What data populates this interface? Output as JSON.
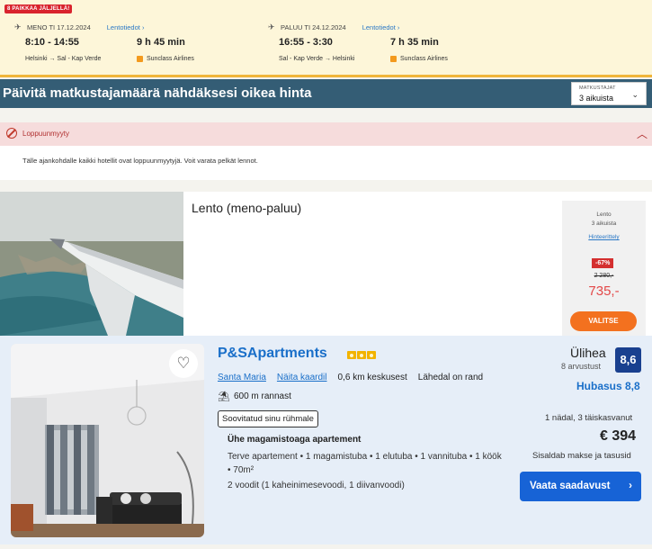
{
  "flight": {
    "seats_badge": "8 PAIKKAA JÄLJELLÄ!",
    "outbound": {
      "label": "MENO TI 17.12.2024",
      "details_link": "Lentotiedot",
      "times": "8:10 - 14:55",
      "duration": "9 h 45 min",
      "route": "Helsinki → Sal - Kap Verde",
      "airline": "Sunclass Airlines"
    },
    "return": {
      "label": "PALUU TI 24.12.2024",
      "details_link": "Lentotiedot",
      "times": "16:55 - 3:30",
      "duration": "7 h 35 min",
      "route": "Sal - Kap Verde → Helsinki",
      "airline": "Sunclass Airlines"
    }
  },
  "banner": {
    "title": "Päivitä matkustajamäärä nähdäksesi oikea hinta",
    "travelers_label": "MATKUSTAJAT",
    "travelers_value": "3 aikuista"
  },
  "alert": {
    "title": "Loppuunmyyty",
    "body": "Tälle ajankohdalle kaikki hotellit ovat loppuunmyytyjä. Voit varata pelkät lennot."
  },
  "flight_product": {
    "title": "Lento (meno-paluu)",
    "price_box": {
      "label": "Lento",
      "travelers": "3 aikuista",
      "details_link": "Hinteerittely",
      "discount": "-67%",
      "old_price": "2 280,-",
      "price": "735,-",
      "button": "VALITSE"
    }
  },
  "hotel": {
    "name": "P&SApartments",
    "stars": 3,
    "location": "Santa Maria",
    "map_link": "Näita kaardil",
    "center_distance": "0,6 km keskusest",
    "beach_note": "Lähedal on rand",
    "beach_distance": "600 m rannast",
    "tag": "Soovitatud sinu rühmale",
    "room_title": "Ühe magamistoaga apartement",
    "room_details": "Terve apartement • 1 magamistuba • 1 elutuba • 1 vannituba • 1 köök • 70m²",
    "room_beds": "2 voodit (1 kaheinimesevoodi, 1 diivanvoodi)",
    "rating_word": "Ülihea",
    "rating_count": "8 arvustust",
    "rating_score": "8,6",
    "clean_score": "Hubasus 8,8",
    "stay_info": "1 nädal, 3 täiskasvanut",
    "price": "€ 394",
    "price_note": "Sisaldab makse ja tasusid",
    "cta": "Vaata saadavust"
  },
  "colors": {
    "banner": "#345d75",
    "flight_box": "#fdf6d9",
    "accent_orange": "#f3711f",
    "link_blue": "#1a6fc9",
    "cta_blue": "#1763d6",
    "discount_red": "#d42f2f"
  }
}
